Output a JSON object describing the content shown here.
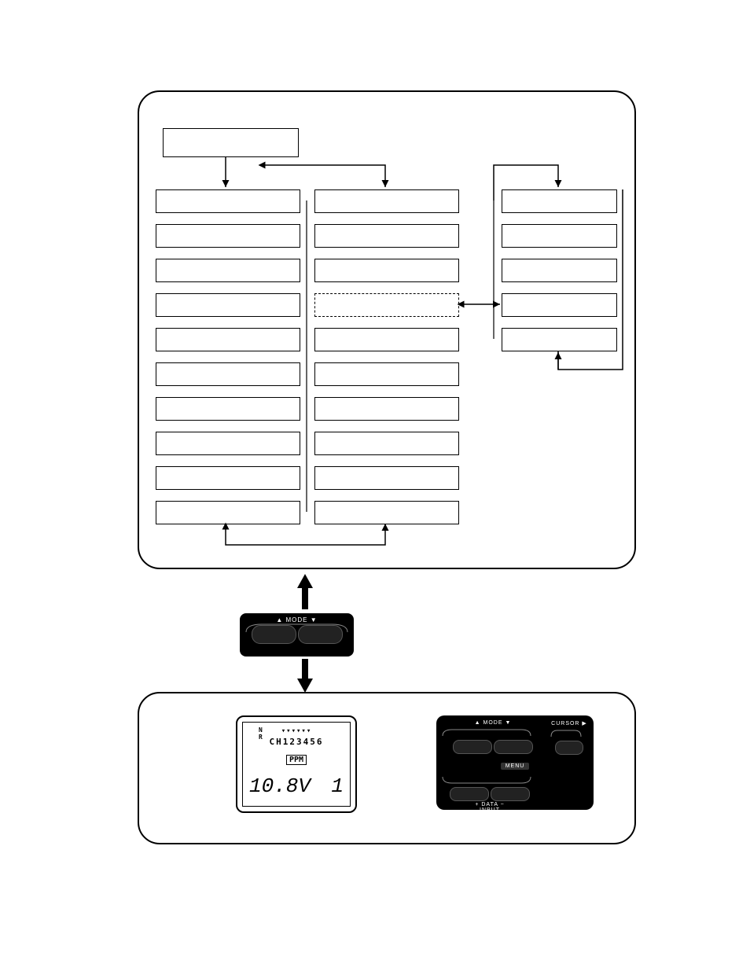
{
  "upper": {
    "header_box": ""
  },
  "mode_pad": {
    "label": "▲  MODE  ▼"
  },
  "lcd": {
    "top_marks": "▾▾▾▾▾▾",
    "nr": "N\nR",
    "ch_row": "CH123456",
    "ppm": "PPM",
    "volts": "10.8V",
    "model": "1"
  },
  "large_pad": {
    "mode": "▲  MODE  ▼",
    "cursor": "CURSOR ▶",
    "menu": "MENU",
    "data": "+  DATA  −",
    "input": "INPUT"
  }
}
